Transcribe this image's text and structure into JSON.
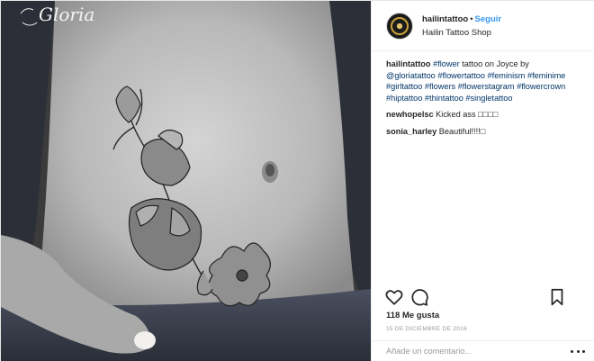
{
  "photo": {
    "watermark": "Gloria"
  },
  "header": {
    "username": "hailintattoo",
    "separator": "•",
    "follow_label": "Seguir",
    "location": "Hailin Tattoo Shop"
  },
  "caption": {
    "username": "hailintattoo",
    "parts": {
      "t1": "#flower",
      "t2": " tattoo on Joyce by ",
      "t3": "@gloriatattoo",
      "t4": "#flowertattoo",
      "t5": "#feminism",
      "t6": "#feminime",
      "t7": "#girltattoo",
      "t8": "#flowers",
      "t9": "#flowerstagram",
      "t10": "#flowercrown",
      "t11": "#hiptattoo",
      "t12": "#thintattoo",
      "t13": "#singletattoo"
    }
  },
  "comments": [
    {
      "username": "newhopelsc",
      "text": "Kicked ass □□□□"
    },
    {
      "username": "sonia_harley",
      "text": "Beautiful!!!!□"
    }
  ],
  "actions": {
    "like_icon": "heart-icon",
    "comment_icon": "comment-icon",
    "save_icon": "bookmark-icon"
  },
  "likes_text": "118 Me gusta",
  "date_text": "15 DE DICIEMBRE DE 2016",
  "add_comment": {
    "placeholder": "Añade un comentario...",
    "options_icon": "more-options-icon"
  }
}
